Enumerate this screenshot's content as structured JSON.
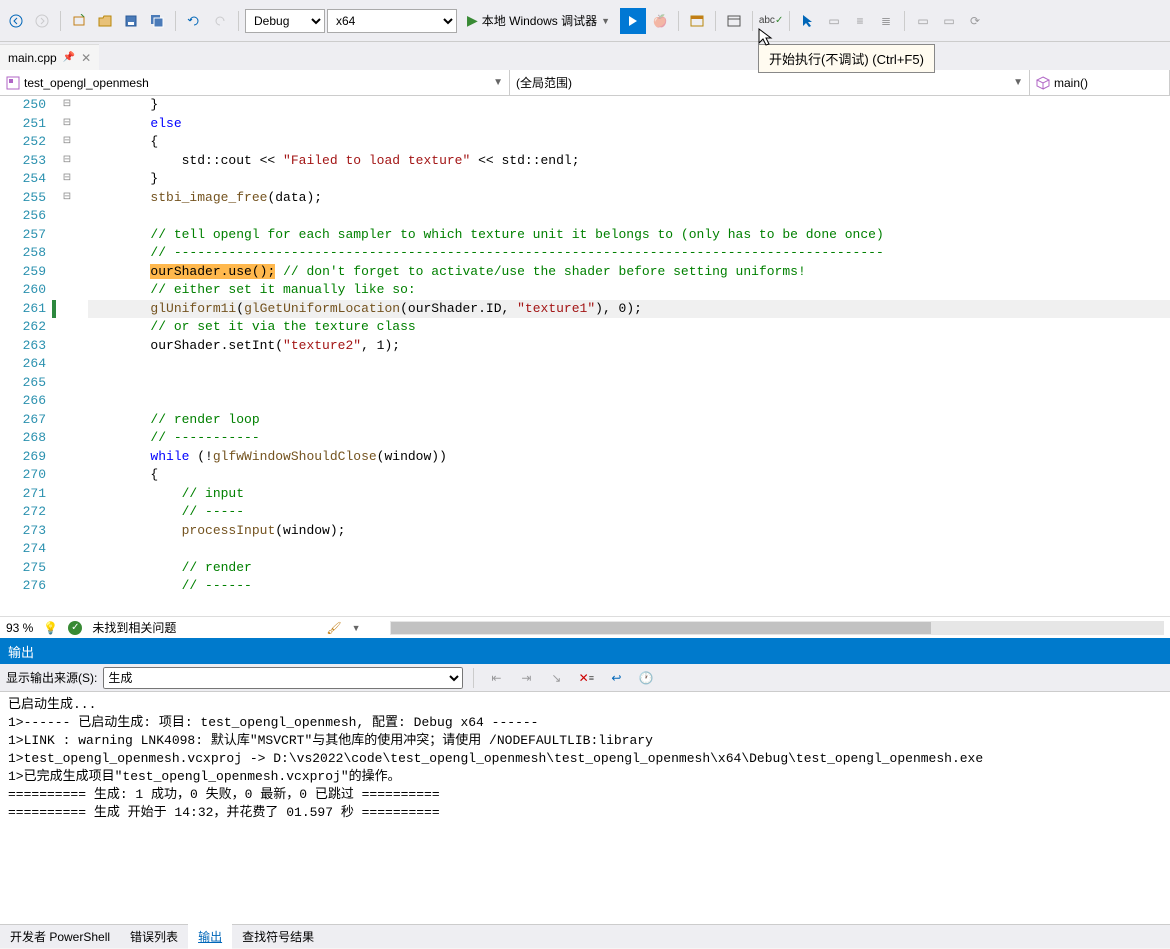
{
  "toolbar": {
    "config": "Debug",
    "platform": "x64",
    "debugger_label": "本地 Windows 调试器"
  },
  "tooltip": "开始执行(不调试) (Ctrl+F5)",
  "tab": {
    "name": "main.cpp"
  },
  "nav": {
    "scope_project": "test_opengl_openmesh",
    "scope_global": "(全局范围)",
    "scope_func": "main()"
  },
  "lines": [
    {
      "n": 250,
      "fold": "",
      "html": "        }"
    },
    {
      "n": 251,
      "fold": "⊟",
      "html": "        <span class='kw'>else</span>"
    },
    {
      "n": 252,
      "fold": "",
      "html": "        {"
    },
    {
      "n": 253,
      "fold": "",
      "html": "            std::cout &lt;&lt; <span class='str'>\"Failed to load texture\"</span> &lt;&lt; std::endl;"
    },
    {
      "n": 254,
      "fold": "",
      "html": "        }"
    },
    {
      "n": 255,
      "fold": "",
      "html": "        <span class='func'>stbi_image_free</span>(data);"
    },
    {
      "n": 256,
      "fold": "",
      "html": ""
    },
    {
      "n": 257,
      "fold": "⊟",
      "html": "        <span class='cmt'>// tell opengl for each sampler to which texture unit it belongs to (only has to be done once)</span>"
    },
    {
      "n": 258,
      "fold": "",
      "html": "        <span class='cmt'>// -------------------------------------------------------------------------------------------</span>"
    },
    {
      "n": 259,
      "fold": "",
      "html": "        <span class='hl'>ourShader.use();</span> <span class='cmt'>// don't forget to activate/use the shader before setting uniforms!</span>"
    },
    {
      "n": 260,
      "fold": "",
      "html": "        <span class='cmt'>// either set it manually like so:</span>"
    },
    {
      "n": 261,
      "fold": "",
      "cur": true,
      "chg": true,
      "html": "        <span class='func'>glUniform1i</span>(<span class='func'>glGetUniformLocation</span>(ourShader.ID, <span class='str'>\"texture1\"</span>), 0);"
    },
    {
      "n": 262,
      "fold": "",
      "html": "        <span class='cmt'>// or set it via the texture class</span>"
    },
    {
      "n": 263,
      "fold": "",
      "html": "        ourShader.setInt(<span class='str'>\"texture2\"</span>, 1);"
    },
    {
      "n": 264,
      "fold": "",
      "html": ""
    },
    {
      "n": 265,
      "fold": "",
      "html": ""
    },
    {
      "n": 266,
      "fold": "",
      "html": ""
    },
    {
      "n": 267,
      "fold": "⊟",
      "html": "        <span class='cmt'>// render loop</span>"
    },
    {
      "n": 268,
      "fold": "",
      "html": "        <span class='cmt'>// -----------</span>"
    },
    {
      "n": 269,
      "fold": "⊟",
      "html": "        <span class='kw'>while</span> (!<span class='func'>glfwWindowShouldClose</span>(window))"
    },
    {
      "n": 270,
      "fold": "",
      "html": "        {"
    },
    {
      "n": 271,
      "fold": "⊟",
      "html": "            <span class='cmt'>// input</span>"
    },
    {
      "n": 272,
      "fold": "",
      "html": "            <span class='cmt'>// -----</span>"
    },
    {
      "n": 273,
      "fold": "",
      "html": "            <span class='func'>processInput</span>(window);"
    },
    {
      "n": 274,
      "fold": "",
      "html": ""
    },
    {
      "n": 275,
      "fold": "⊟",
      "html": "            <span class='cmt'>// render</span>"
    },
    {
      "n": 276,
      "fold": "",
      "html": "            <span class='cmt'>// ------</span>"
    }
  ],
  "status": {
    "zoom": "93 %",
    "issues": "未找到相关问题"
  },
  "output": {
    "title": "输出",
    "source_label": "显示输出来源(S):",
    "source_value": "生成",
    "text": "已启动生成...\n1>------ 已启动生成: 项目: test_opengl_openmesh, 配置: Debug x64 ------\n1>LINK : warning LNK4098: 默认库\"MSVCRT\"与其他库的使用冲突；请使用 /NODEFAULTLIB:library\n1>test_opengl_openmesh.vcxproj -> D:\\vs2022\\code\\test_opengl_openmesh\\test_opengl_openmesh\\x64\\Debug\\test_opengl_openmesh.exe\n1>已完成生成项目\"test_opengl_openmesh.vcxproj\"的操作。\n========== 生成: 1 成功，0 失败，0 最新，0 已跳过 ==========\n========== 生成 开始于 14:32，并花费了 01.597 秒 =========="
  },
  "bottom_tabs": {
    "t1": "开发者 PowerShell",
    "t2": "错误列表",
    "t3": "输出",
    "t4": "查找符号结果"
  }
}
